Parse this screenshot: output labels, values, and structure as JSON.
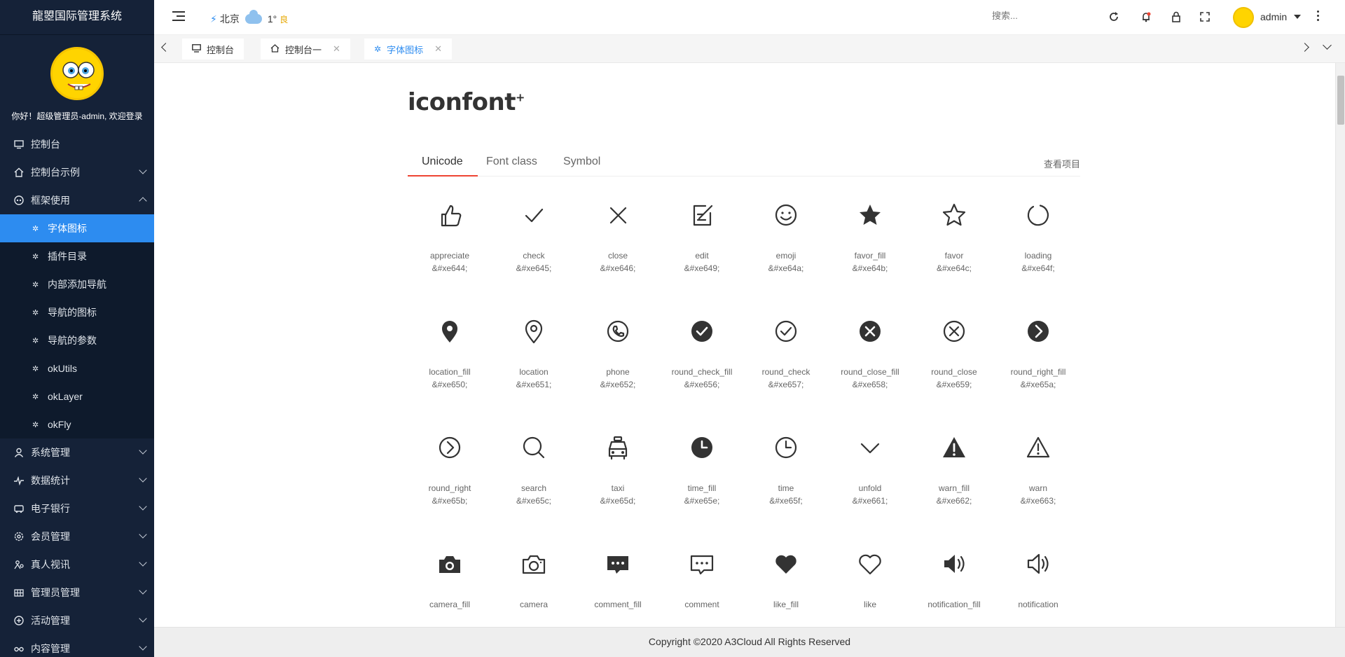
{
  "app": {
    "title": "龍曌国际管理系统",
    "welcome": "你好！超级管理员-admin, 欢迎登录"
  },
  "sidebar": {
    "items": [
      {
        "label": "控制台",
        "icon": "monitor-icon",
        "expandable": false
      },
      {
        "label": "控制台示例",
        "icon": "home-icon",
        "expandable": true
      },
      {
        "label": "框架使用",
        "icon": "framework-icon",
        "expandable": true,
        "expanded": true,
        "children": [
          "字体图标",
          "插件目录",
          "内部添加导航",
          "导航的图标",
          "导航的参数",
          "okUtils",
          "okLayer",
          "okFly"
        ]
      },
      {
        "label": "系统管理",
        "icon": "user-icon",
        "expandable": true
      },
      {
        "label": "数据统计",
        "icon": "pulse-icon",
        "expandable": true
      },
      {
        "label": "电子银行",
        "icon": "bus-icon",
        "expandable": true
      },
      {
        "label": "会员管理",
        "icon": "gear-icon",
        "expandable": true
      },
      {
        "label": "真人视讯",
        "icon": "people-icon",
        "expandable": true
      },
      {
        "label": "管理员管理",
        "icon": "grid-icon",
        "expandable": true
      },
      {
        "label": "活动管理",
        "icon": "plus-circle-icon",
        "expandable": true
      },
      {
        "label": "内容管理",
        "icon": "glasses-icon",
        "expandable": true
      }
    ],
    "active_child": "字体图标"
  },
  "topbar": {
    "city": "北京",
    "temperature": "1°",
    "air_quality": "良",
    "search_placeholder": "搜索...",
    "username": "admin",
    "icons": [
      "refresh-icon",
      "bell-icon",
      "lock-icon",
      "fullscreen-icon"
    ]
  },
  "tabs": [
    {
      "label": "控制台",
      "icon": "monitor-icon",
      "closable": false,
      "active": false
    },
    {
      "label": "控制台一",
      "icon": "home-icon",
      "closable": true,
      "active": false
    },
    {
      "label": "字体图标",
      "icon": "palm-icon",
      "closable": true,
      "active": true
    }
  ],
  "iconfont": {
    "logo": "iconfont",
    "logo_plus": "+",
    "tabs": [
      "Unicode",
      "Font class",
      "Symbol"
    ],
    "active_tab": "Unicode",
    "view_project": "查看项目",
    "accent_color": "#ee3322",
    "icons": [
      {
        "name": "appreciate",
        "code": "&#xe644;"
      },
      {
        "name": "check",
        "code": "&#xe645;"
      },
      {
        "name": "close",
        "code": "&#xe646;"
      },
      {
        "name": "edit",
        "code": "&#xe649;"
      },
      {
        "name": "emoji",
        "code": "&#xe64a;"
      },
      {
        "name": "favor_fill",
        "code": "&#xe64b;"
      },
      {
        "name": "favor",
        "code": "&#xe64c;"
      },
      {
        "name": "loading",
        "code": "&#xe64f;"
      },
      {
        "name": "location_fill",
        "code": "&#xe650;"
      },
      {
        "name": "location",
        "code": "&#xe651;"
      },
      {
        "name": "phone",
        "code": "&#xe652;"
      },
      {
        "name": "round_check_fill",
        "code": "&#xe656;"
      },
      {
        "name": "round_check",
        "code": "&#xe657;"
      },
      {
        "name": "round_close_fill",
        "code": "&#xe658;"
      },
      {
        "name": "round_close",
        "code": "&#xe659;"
      },
      {
        "name": "round_right_fill",
        "code": "&#xe65a;"
      },
      {
        "name": "round_right",
        "code": "&#xe65b;"
      },
      {
        "name": "search",
        "code": "&#xe65c;"
      },
      {
        "name": "taxi",
        "code": "&#xe65d;"
      },
      {
        "name": "time_fill",
        "code": "&#xe65e;"
      },
      {
        "name": "time",
        "code": "&#xe65f;"
      },
      {
        "name": "unfold",
        "code": "&#xe661;"
      },
      {
        "name": "warn_fill",
        "code": "&#xe662;"
      },
      {
        "name": "warn",
        "code": "&#xe663;"
      },
      {
        "name": "camera_fill",
        "code": ""
      },
      {
        "name": "camera",
        "code": ""
      },
      {
        "name": "comment_fill",
        "code": ""
      },
      {
        "name": "comment",
        "code": ""
      },
      {
        "name": "like_fill",
        "code": ""
      },
      {
        "name": "like",
        "code": ""
      },
      {
        "name": "notification_fill",
        "code": ""
      },
      {
        "name": "notification",
        "code": ""
      }
    ]
  },
  "footer": {
    "copyright": "Copyright ©2020 A3Cloud All Rights Reserved"
  }
}
